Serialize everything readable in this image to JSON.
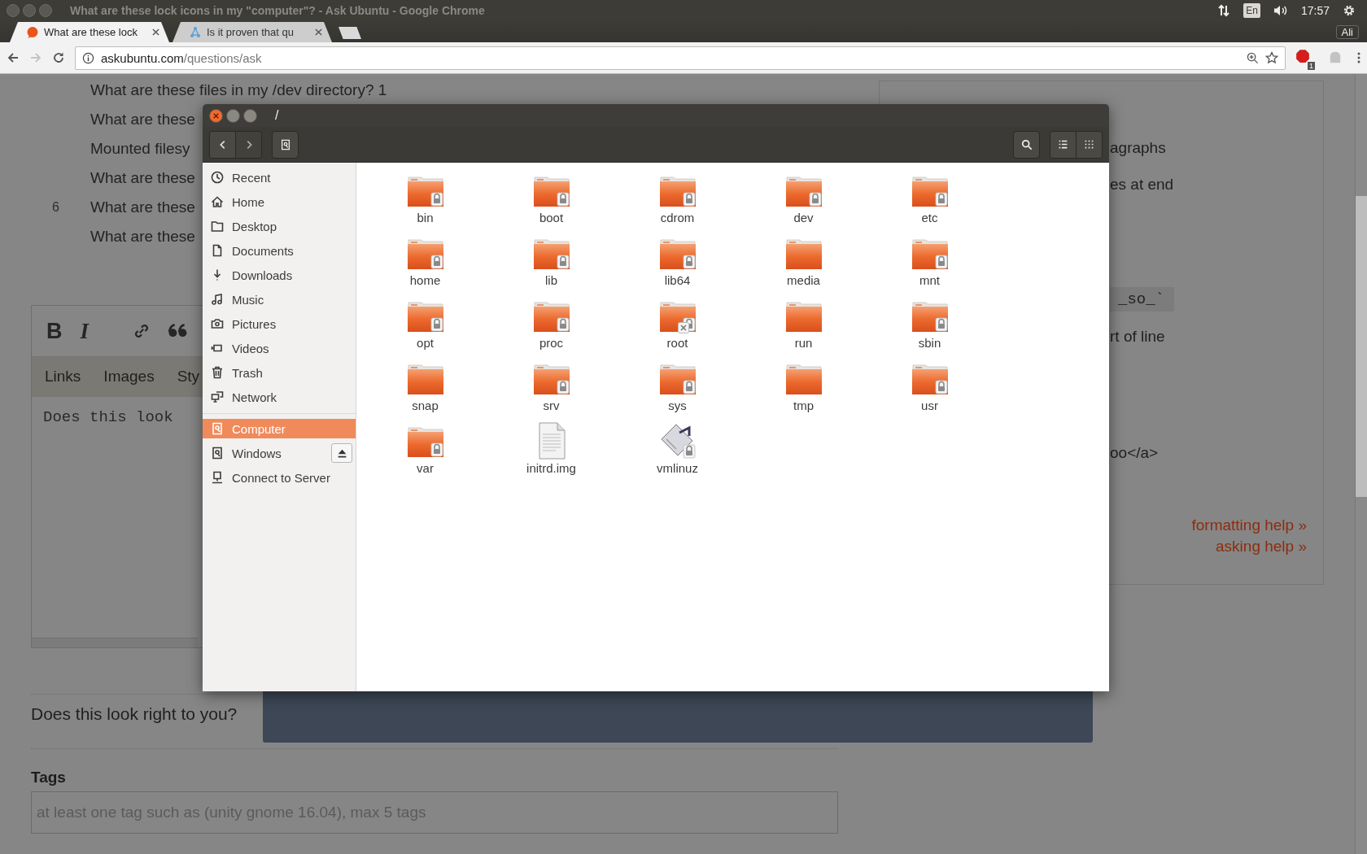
{
  "window_title": "What are these lock icons in my \"computer\"? - Ask Ubuntu - Google Chrome",
  "panel": {
    "keyboard": "En",
    "clock": "17:57",
    "user": "Ali"
  },
  "tabs": [
    {
      "label": "What are these lock",
      "selected": true
    },
    {
      "label": "Is it proven that qu",
      "selected": false
    }
  ],
  "address": {
    "host": "askubuntu.com",
    "path": "/questions/ask"
  },
  "extension_badge": "1",
  "related": [
    {
      "text": "What are these files in my /dev directory? 1"
    },
    {
      "text": "What are these"
    },
    {
      "text": "Mounted filesy"
    },
    {
      "text": "What are these"
    },
    {
      "count": "6",
      "text": "What are these"
    },
    {
      "text": "What are these"
    }
  ],
  "editor": {
    "tools": [
      "B",
      "I"
    ],
    "help_tabs": [
      "Links",
      "Images",
      "Sty"
    ],
    "value": "Does this look"
  },
  "preview_prompt": "Does this look right to you?",
  "tags": {
    "label": "Tags",
    "placeholder": "at least one tag such as (unity gnome 16.04), max 5 tags"
  },
  "help_sidebar": {
    "lines": [
      {
        "kind": "text",
        "text": "agraphs"
      },
      {
        "kind": "text",
        "text": "es at end"
      },
      {
        "kind": "code",
        "text": "_so_`"
      },
      {
        "kind": "text",
        "text": "rt of line"
      },
      {
        "kind": "text",
        "text": "oo</a>"
      }
    ],
    "links": [
      "formatting help »",
      "asking help »"
    ]
  },
  "file_manager": {
    "title": "/",
    "places": [
      {
        "label": "Recent",
        "selected": false
      },
      {
        "label": "Home",
        "selected": false
      },
      {
        "label": "Desktop",
        "selected": false
      },
      {
        "label": "Documents",
        "selected": false
      },
      {
        "label": "Downloads",
        "selected": false
      },
      {
        "label": "Music",
        "selected": false
      },
      {
        "label": "Pictures",
        "selected": false
      },
      {
        "label": "Videos",
        "selected": false
      },
      {
        "label": "Trash",
        "selected": false
      },
      {
        "label": "Network",
        "selected": false
      }
    ],
    "devices": [
      {
        "label": "Computer",
        "selected": true,
        "ejectable": false
      },
      {
        "label": "Windows",
        "selected": false,
        "ejectable": true
      },
      {
        "label": "Connect to Server",
        "selected": false,
        "ejectable": false
      }
    ],
    "files": [
      {
        "name": "bin",
        "kind": "folder",
        "locked": true,
        "unreadable": false
      },
      {
        "name": "boot",
        "kind": "folder",
        "locked": true,
        "unreadable": false
      },
      {
        "name": "cdrom",
        "kind": "folder",
        "locked": true,
        "unreadable": false
      },
      {
        "name": "dev",
        "kind": "folder",
        "locked": true,
        "unreadable": false
      },
      {
        "name": "etc",
        "kind": "folder",
        "locked": true,
        "unreadable": false
      },
      {
        "name": "home",
        "kind": "folder",
        "locked": true,
        "unreadable": false
      },
      {
        "name": "lib",
        "kind": "folder",
        "locked": true,
        "unreadable": false
      },
      {
        "name": "lib64",
        "kind": "folder",
        "locked": true,
        "unreadable": false
      },
      {
        "name": "media",
        "kind": "folder",
        "locked": false,
        "unreadable": false
      },
      {
        "name": "mnt",
        "kind": "folder",
        "locked": true,
        "unreadable": false
      },
      {
        "name": "opt",
        "kind": "folder",
        "locked": true,
        "unreadable": false
      },
      {
        "name": "proc",
        "kind": "folder",
        "locked": true,
        "unreadable": false
      },
      {
        "name": "root",
        "kind": "folder",
        "locked": true,
        "unreadable": true
      },
      {
        "name": "run",
        "kind": "folder",
        "locked": false,
        "unreadable": false
      },
      {
        "name": "sbin",
        "kind": "folder",
        "locked": true,
        "unreadable": false
      },
      {
        "name": "snap",
        "kind": "folder",
        "locked": false,
        "unreadable": false
      },
      {
        "name": "srv",
        "kind": "folder",
        "locked": true,
        "unreadable": false
      },
      {
        "name": "sys",
        "kind": "folder",
        "locked": true,
        "unreadable": false
      },
      {
        "name": "tmp",
        "kind": "folder",
        "locked": false,
        "unreadable": false
      },
      {
        "name": "usr",
        "kind": "folder",
        "locked": true,
        "unreadable": false
      },
      {
        "name": "var",
        "kind": "folder",
        "locked": true,
        "unreadable": false
      },
      {
        "name": "initrd.img",
        "kind": "document",
        "locked": false,
        "unreadable": false
      },
      {
        "name": "vmlinuz",
        "kind": "kernel",
        "locked": true,
        "unreadable": false
      }
    ]
  }
}
